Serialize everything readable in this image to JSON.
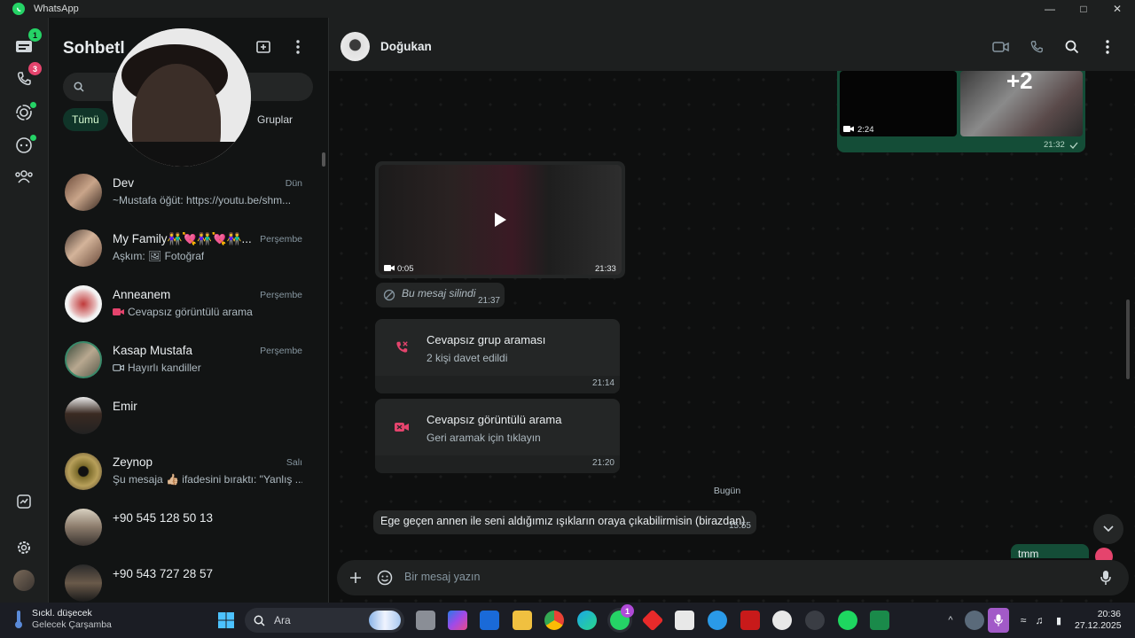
{
  "window": {
    "title": "WhatsApp"
  },
  "rail": {
    "chats_badge": "1",
    "calls_badge": "3"
  },
  "list": {
    "title": "Sohbetler",
    "title_visible": "Sohbetl",
    "search_placeholder": "n",
    "filters": [
      "Tümü",
      "Gruplar"
    ],
    "chats": [
      {
        "name": "Dev",
        "time": "Dün",
        "preview": "~Mustafa öğüt: https://youtu.be/shm..."
      },
      {
        "name": "My Family👫💘👫💘👫...",
        "time": "Perşembe",
        "preview": "Aşkım: 🖼 Fotoğraf"
      },
      {
        "name": "Anneanem",
        "time": "Perşembe",
        "preview": "Cevapsız görüntülü arama"
      },
      {
        "name": "Kasap Mustafa",
        "time": "Perşembe",
        "preview": "Hayırlı kandiller"
      },
      {
        "name": "Emir",
        "time": "",
        "preview": ""
      },
      {
        "name": "Zeynop",
        "time": "Salı",
        "preview": "Şu mesaja 👍🏼 ifadesini bıraktı: \"Yanlış ..."
      },
      {
        "name": "+90 545 128 50 13",
        "time": "",
        "preview": ""
      },
      {
        "name": "+90 543 727 28 57",
        "time": "",
        "preview": ""
      }
    ]
  },
  "conversation": {
    "contact_name": "Doğukan",
    "media_top": {
      "duration": "2:24",
      "more": "+2",
      "time": "21:32"
    },
    "video_msg": {
      "duration": "0:05",
      "time": "21:33"
    },
    "deleted_msg": {
      "text": "Bu mesaj silindi",
      "time": "21:37"
    },
    "missed_group_call": {
      "title": "Cevapsız grup araması",
      "subtitle": "2 kişi davet edildi",
      "time": "21:14"
    },
    "missed_video_call": {
      "title": "Cevapsız görüntülü arama",
      "subtitle": "Geri aramak için tıklayın",
      "time": "21:20"
    },
    "day_separator": "Bugün",
    "text_msg": {
      "text": "Ege geçen annen ile seni aldığımız ışıkların oraya çıkabilirmisin (birazdan)",
      "time": "15:55"
    },
    "out_msg": {
      "text": "tmm"
    },
    "composer_placeholder": "Bir mesaj yazın"
  },
  "taskbar": {
    "weather_title": "Sıckl. düşecek",
    "weather_sub": "Gelecek Çarşamba",
    "search_label": "Ara",
    "whatsapp_badge": "1",
    "time": "20:36",
    "date": "27.12.2025"
  },
  "colors": {
    "accent": "#25d366",
    "outgoing_bubble": "#144d37",
    "incoming_bubble": "#242626",
    "missed": "#e5446d"
  }
}
